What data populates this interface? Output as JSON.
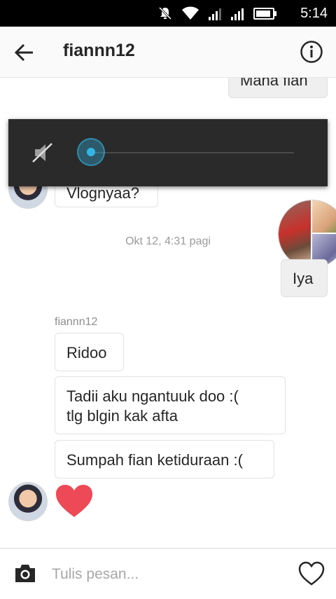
{
  "status_bar": {
    "time": "5:14"
  },
  "header": {
    "title": "fiannn12"
  },
  "messages": {
    "top_partial": "Mana fian",
    "partial_left": "Vlognyaa?",
    "timestamp": "Okt 12, 4:31 pagi",
    "outgoing": "Iya",
    "sender_name": "fiannn12",
    "incoming": [
      "Ridoo",
      "Tadii aku ngantuuk doo :(\ntlg blgin kak afta",
      "Sumpah fian ketiduraan :("
    ]
  },
  "volume_overlay": {
    "level": 0,
    "icon": "volume-muted-icon"
  },
  "composer": {
    "placeholder": "Tulis pesan..."
  },
  "colors": {
    "heart": "#ed4956",
    "volume_accent": "#33b5e5"
  }
}
